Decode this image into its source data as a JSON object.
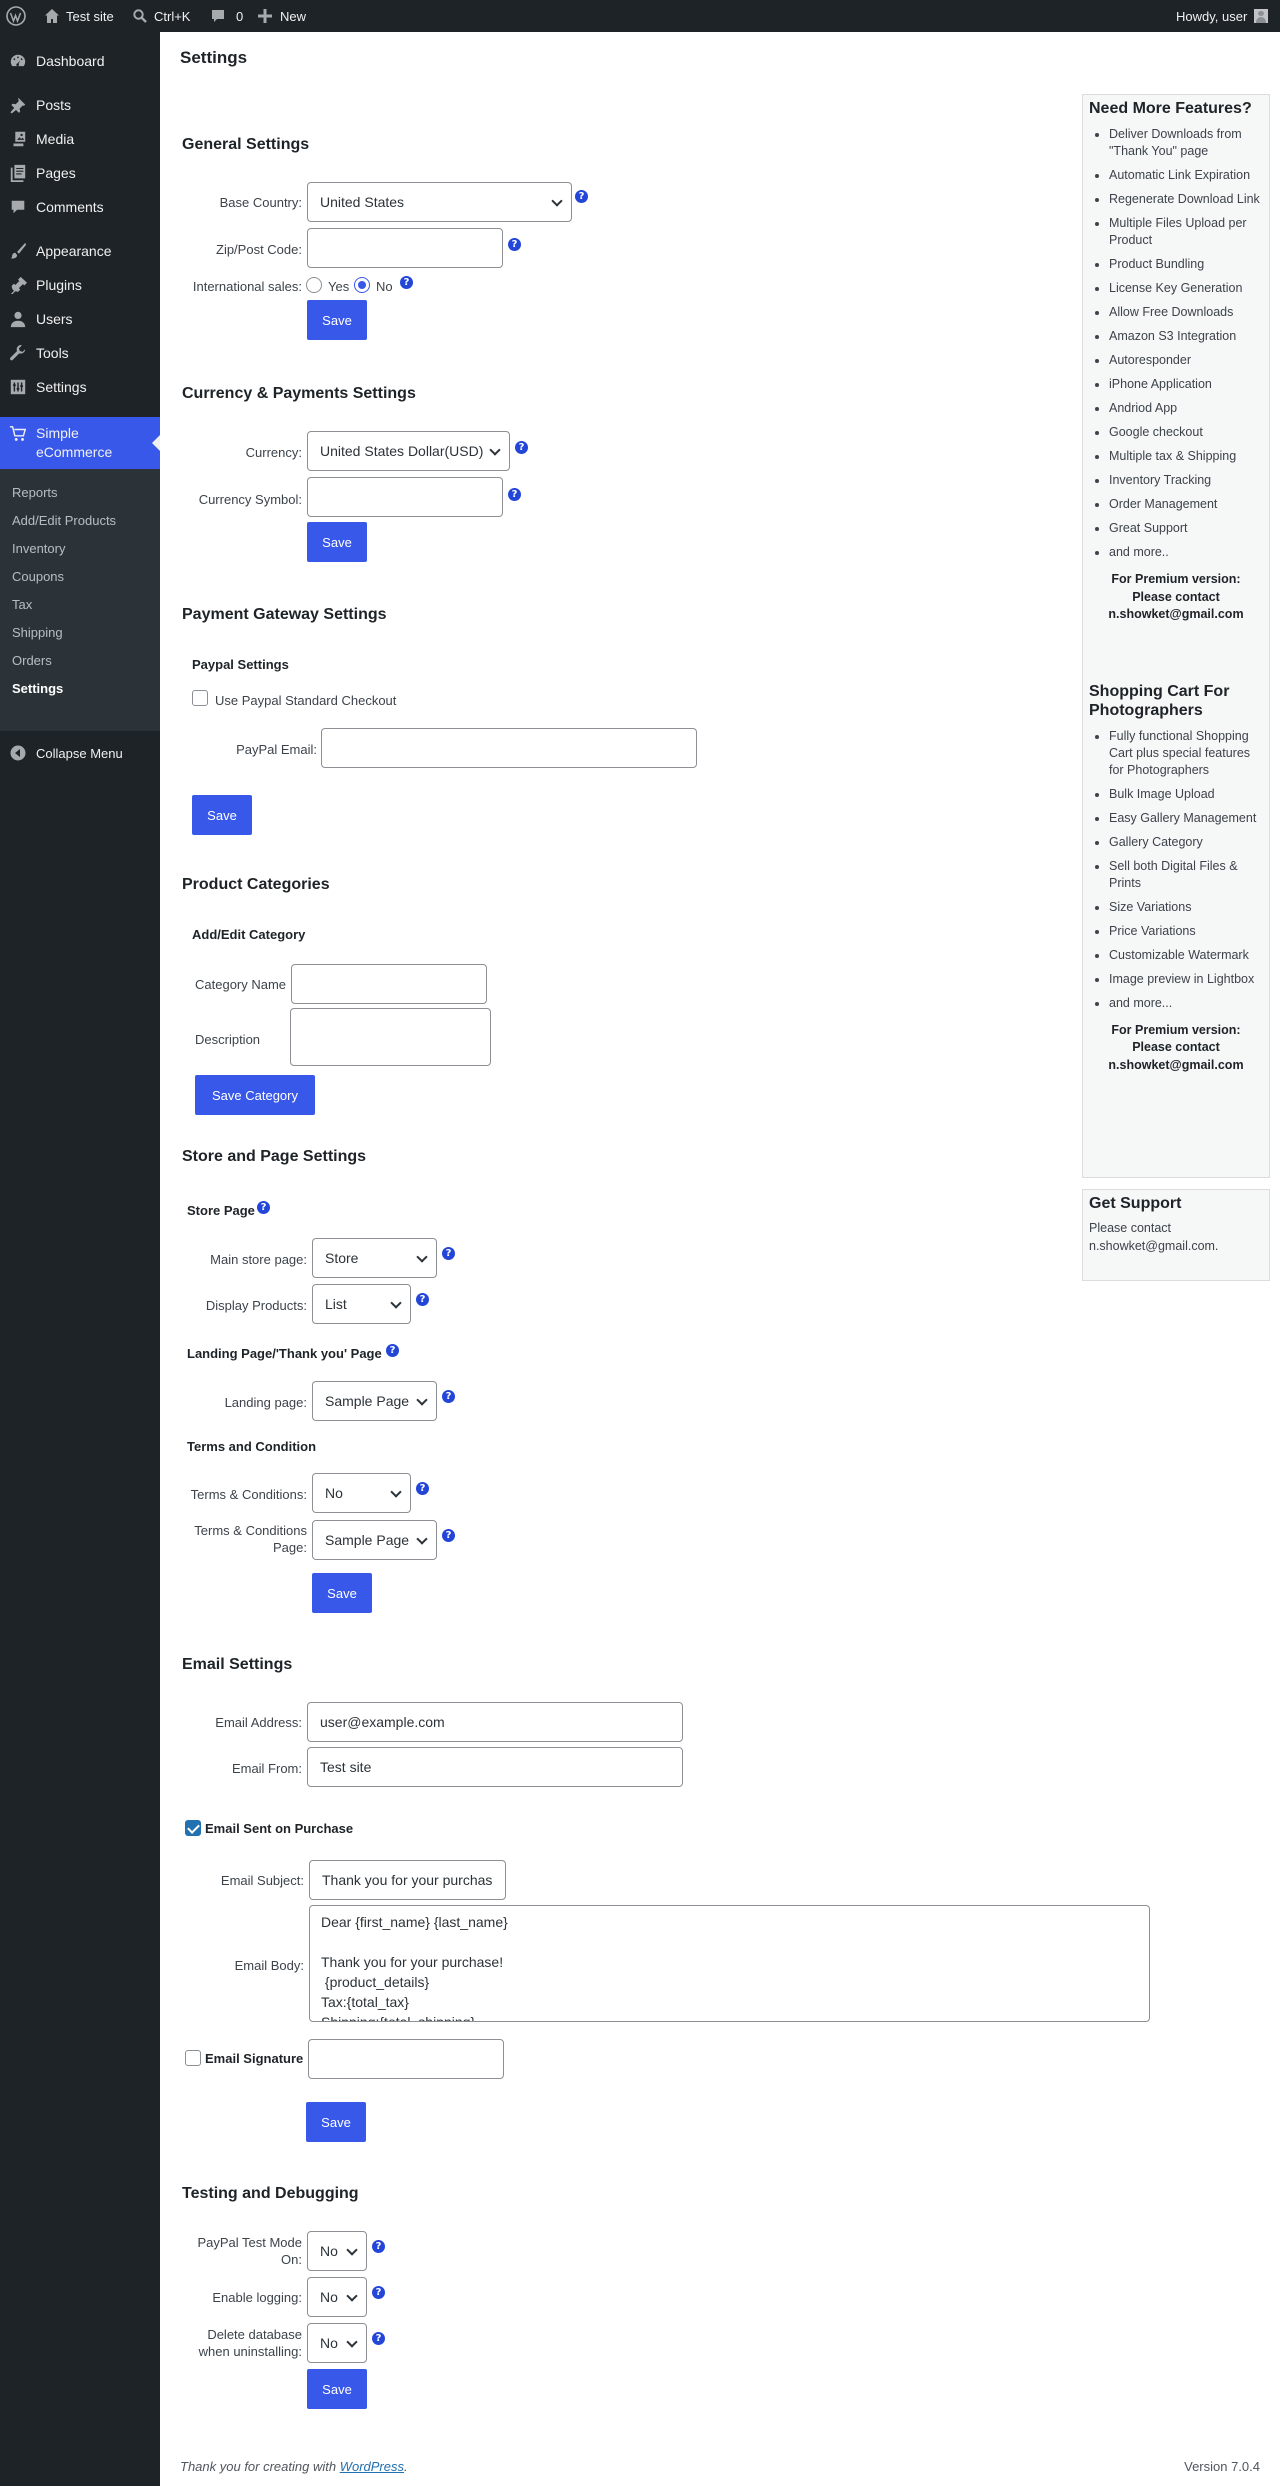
{
  "adminbar": {
    "site_name": "Test site",
    "search_shortcut": "Ctrl+K",
    "comments_count": "0",
    "new_label": "New",
    "greeting": "Howdy, user"
  },
  "menu": {
    "dashboard": "Dashboard",
    "posts": "Posts",
    "media": "Media",
    "pages": "Pages",
    "comments": "Comments",
    "appearance": "Appearance",
    "plugins": "Plugins",
    "users": "Users",
    "tools": "Tools",
    "settings": "Settings",
    "plugin": "Simple eCommerce",
    "submenu": [
      "Reports",
      "Add/Edit Products",
      "Inventory",
      "Coupons",
      "Tax",
      "Shipping",
      "Orders",
      "Settings"
    ],
    "collapse": "Collapse Menu"
  },
  "page_title": "Settings",
  "general": {
    "heading": "General Settings",
    "country_label": "Base Country:",
    "country_value": "United States",
    "zip_label": "Zip/Post Code:",
    "zip_value": "",
    "intl_label": "International sales:",
    "yes": "Yes",
    "no": "No",
    "intl_selected": "No",
    "save": "Save"
  },
  "currency": {
    "heading": "Currency & Payments Settings",
    "currency_label": "Currency:",
    "currency_value": "United States Dollar(USD)",
    "symbol_label": "Currency Symbol:",
    "symbol_value": "",
    "save": "Save"
  },
  "gateway": {
    "heading": "Payment Gateway Settings",
    "paypal_heading": "Paypal Settings",
    "paypal_checkbox": "Use Paypal Standard Checkout",
    "paypal_checked": false,
    "email_label": "PayPal Email:",
    "email_value": "",
    "save": "Save"
  },
  "categories": {
    "heading": "Product Categories",
    "sub_heading": "Add/Edit Category",
    "name_label": "Category Name",
    "desc_label": "Description",
    "save": "Save Category"
  },
  "store": {
    "heading": "Store and Page Settings",
    "store_page_heading": "Store Page",
    "main_label": "Main store page:",
    "main_value": "Store",
    "display_label": "Display Products:",
    "display_value": "List",
    "landing_heading": "Landing Page/'Thank you' Page",
    "landing_label": "Landing page:",
    "landing_value": "Sample Page",
    "terms_heading": "Terms and Condition",
    "terms_label": "Terms & Conditions:",
    "terms_value": "No",
    "terms_page_label": "Terms & Conditions Page:",
    "terms_page_value": "Sample Page",
    "save": "Save"
  },
  "email": {
    "heading": "Email Settings",
    "address_label": "Email Address:",
    "address_value": "user@example.com",
    "from_label": "Email From:",
    "from_value": "Test site",
    "purchase_label": "Email Sent on Purchase",
    "purchase_checked": true,
    "subject_label": "Email Subject:",
    "subject_value": "Thank you for your purchas",
    "body_label": "Email Body:",
    "body_value": "Dear {first_name} {last_name}\n\nThank you for your purchase!\n {product_details}\nTax:{total_tax}\nShipping:{total_shipping}",
    "signature_label": "Email Signature",
    "signature_checked": false,
    "save": "Save"
  },
  "debug": {
    "heading": "Testing and Debugging",
    "test_label": "PayPal Test Mode On:",
    "test_value": "No",
    "log_label": "Enable logging:",
    "log_value": "No",
    "delete_label": "Delete database when uninstalling:",
    "delete_value": "No",
    "save": "Save"
  },
  "sidebar": {
    "features_title": "Need More Features?",
    "features": [
      "Deliver Downloads from \"Thank You\" page",
      "Automatic Link Expiration",
      "Regenerate Download Link",
      "Multiple Files Upload per Product",
      "Product Bundling",
      "License Key Generation",
      "Allow Free Downloads",
      "Amazon S3 Integration",
      "Autoresponder",
      "iPhone Application",
      "Andriod App",
      "Google checkout",
      "Multiple tax & Shipping",
      "Inventory Tracking",
      "Order Management",
      "Great Support",
      "and more.."
    ],
    "premium_line1": "For Premium version:",
    "premium_line2": "Please contact",
    "premium_email": "n.showket@gmail.com",
    "photo_title": "Shopping Cart For Photographers",
    "photo_features": [
      "Fully functional Shopping Cart plus special features for Photographers",
      "Bulk Image Upload",
      "Easy Gallery Management",
      "Gallery Category",
      "Sell both Digital Files & Prints",
      "Size Variations",
      "Price Variations",
      "Customizable Watermark",
      "Image preview in Lightbox",
      "and more..."
    ],
    "support_title": "Get Support",
    "support_text": "Please contact n.showket@gmail.com."
  },
  "footer": {
    "thanks_prefix": "Thank you for creating with ",
    "wp_link": "WordPress",
    "thanks_suffix": ".",
    "version": "Version 7.0.4"
  },
  "colors": {
    "accent": "#3858e9",
    "adminbar": "#1d2327",
    "help": "#2346d9"
  }
}
